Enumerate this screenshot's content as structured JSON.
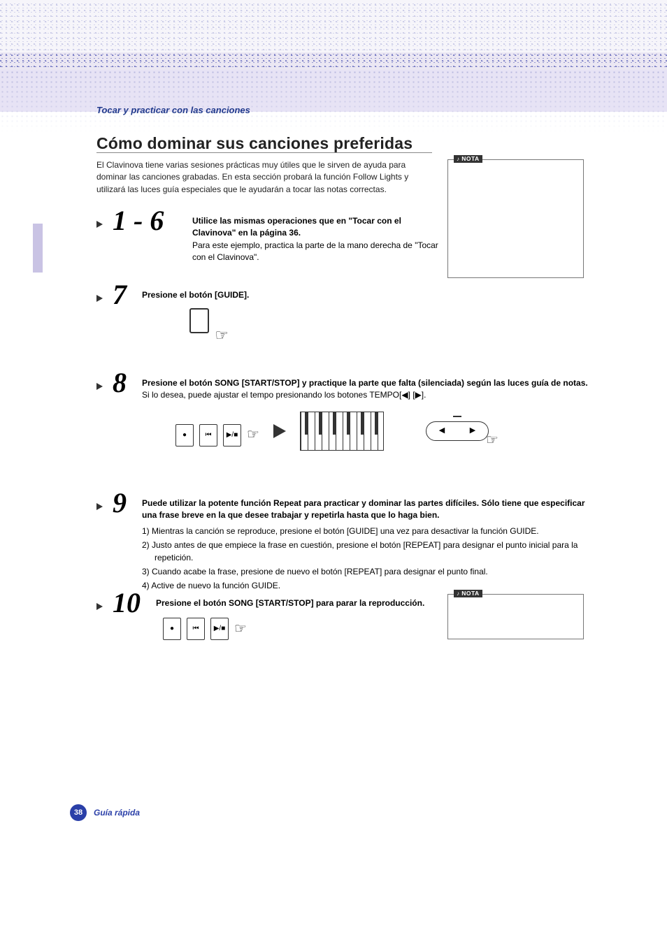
{
  "header": {
    "section": "Tocar y practicar con las canciones",
    "title": "Cómo dominar sus canciones preferidas",
    "intro": "El Clavinova tiene varias sesiones prácticas muy útiles que le sirven de ayuda para dominar las canciones grabadas. En esta sección probará la función Follow Lights y utilizará las luces guía especiales que le ayudarán a tocar las notas correctas."
  },
  "notes": {
    "label": "NOTA",
    "note1": "",
    "note2": ""
  },
  "steps": {
    "s16": {
      "num": "1 - 6",
      "lead": "Utilice las mismas operaciones que en \"Tocar con el Clavinova\" en la página 36.",
      "sub": "Para este ejemplo, practica la parte de la mano derecha de \"Tocar con el Clavinova\"."
    },
    "s7": {
      "num": "7",
      "lead": "Presione el botón [GUIDE]."
    },
    "s8": {
      "num": "8",
      "lead": "Presione el botón SONG [START/STOP] y practique la parte que falta (silenciada) según las luces guía de notas.",
      "sub": "Si lo desea, puede ajustar el tempo presionando los botones TEMPO[◀] [▶]."
    },
    "s9": {
      "num": "9",
      "lead": "Puede utilizar la potente función Repeat para practicar y dominar las partes difíciles. Sólo tiene que especificar una frase breve en la que desee trabajar y repetirla hasta que lo haga bien.",
      "items": {
        "i1": "1) Mientras la canción se reproduce, presione el botón [GUIDE] una vez para desactivar la función GUIDE.",
        "i2": "2) Justo antes de que empiece la frase en cuestión, presione el botón [REPEAT] para designar el punto inicial para la repetición.",
        "i3": "3) Cuando acabe la frase, presione de nuevo el botón [REPEAT] para designar el punto final.",
        "i4": "4) Active de nuevo la función GUIDE."
      }
    },
    "s10": {
      "num": "10",
      "lead": "Presione el botón SONG [START/STOP] para parar la reproducción."
    }
  },
  "buttons": {
    "rec": "●",
    "top": "⏮",
    "play": "▶/■"
  },
  "footer": {
    "page": "38",
    "label": "Guía rápida"
  }
}
